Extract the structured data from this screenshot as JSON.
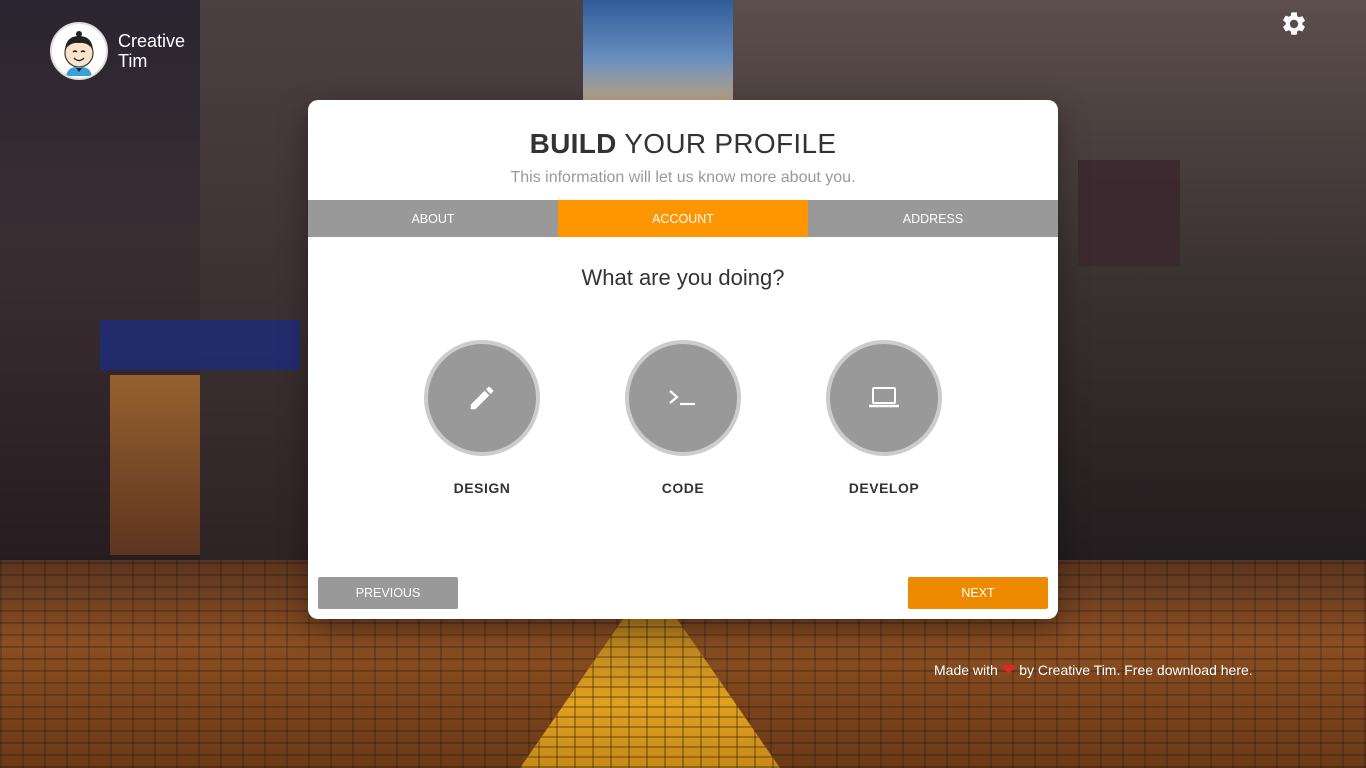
{
  "brand": {
    "name_line1": "Creative",
    "name_line2": "Tim",
    "logo_icon": "cartoon-avatar"
  },
  "header": {
    "settings_icon": "gear-icon"
  },
  "wizard": {
    "title_bold": "BUILD",
    "title_rest": " YOUR PROFILE",
    "subtitle": "This information will let us know more about you.",
    "tabs": [
      {
        "label": "ABOUT",
        "active": false
      },
      {
        "label": "ACCOUNT",
        "active": true
      },
      {
        "label": "ADDRESS",
        "active": false
      }
    ],
    "question": "What are you doing?",
    "choices": [
      {
        "label": "DESIGN",
        "icon": "pencil-icon"
      },
      {
        "label": "CODE",
        "icon": "terminal-icon"
      },
      {
        "label": "DEVELOP",
        "icon": "laptop-icon"
      }
    ],
    "previous_label": "PREVIOUS",
    "next_label": "NEXT"
  },
  "footer": {
    "made_with": "Made with",
    "by_text": "by Creative Tim. Free download here."
  },
  "colors": {
    "accent": "#ff9500",
    "tab_bg": "#999999",
    "next_button": "#ee8a00",
    "heart": "#e3242b"
  }
}
